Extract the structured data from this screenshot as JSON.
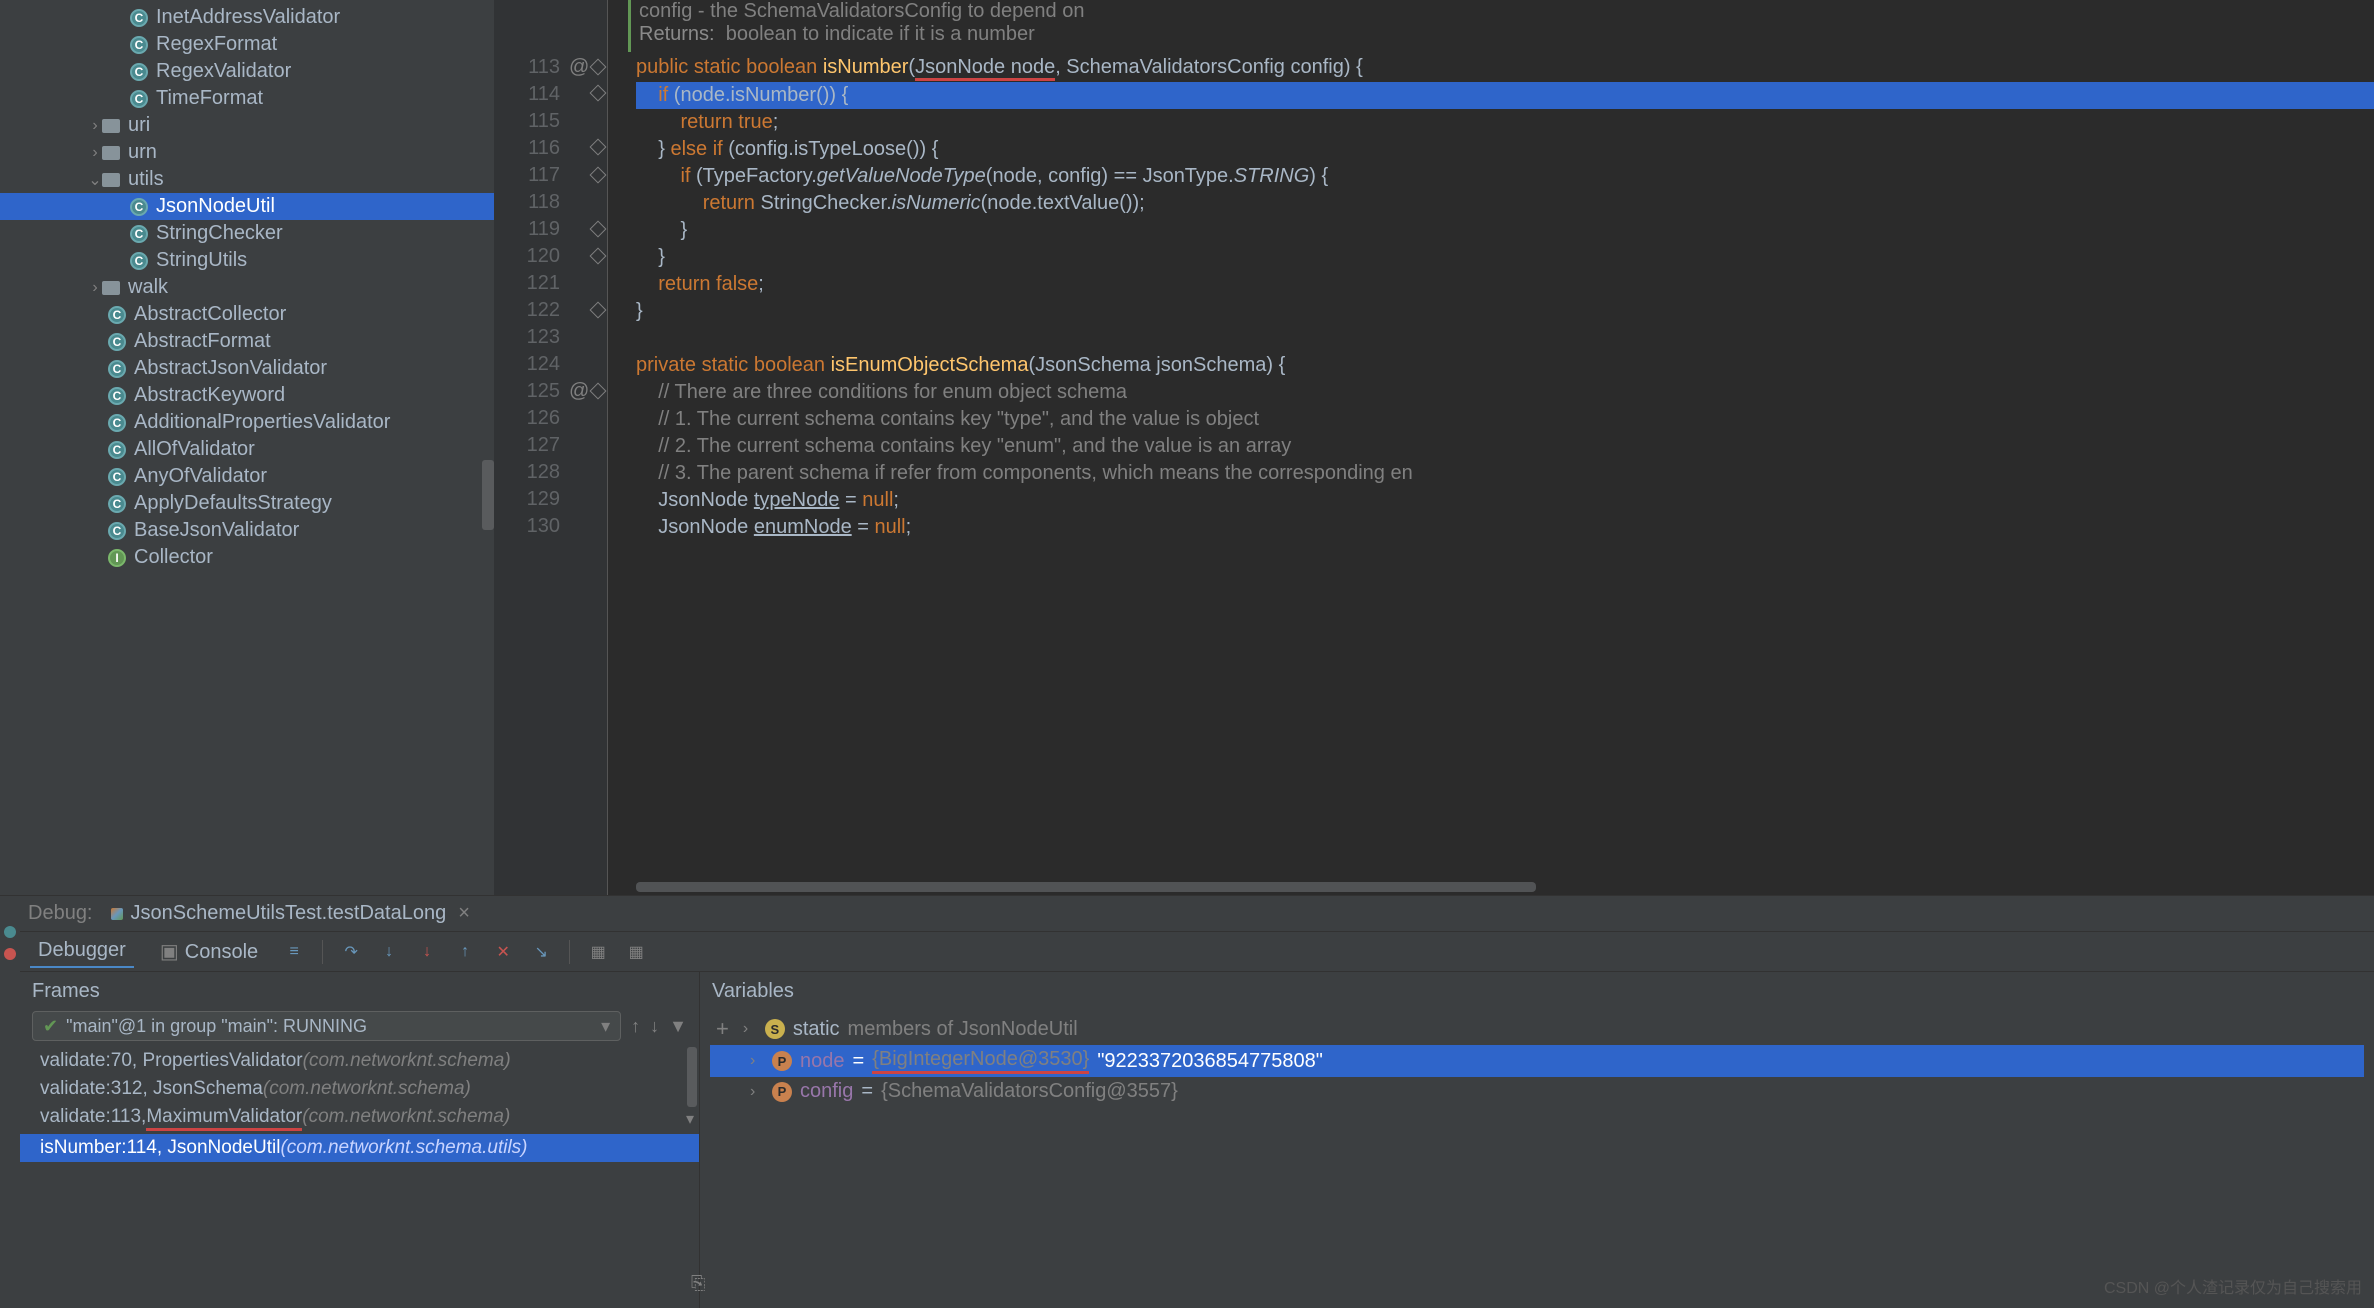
{
  "tree": {
    "items": [
      {
        "indent": 130,
        "icon": "class",
        "label": "InetAddressValidator"
      },
      {
        "indent": 130,
        "icon": "class",
        "label": "RegexFormat"
      },
      {
        "indent": 130,
        "icon": "class",
        "label": "RegexValidator"
      },
      {
        "indent": 130,
        "icon": "class",
        "label": "TimeFormat"
      },
      {
        "indent": 88,
        "chev": "›",
        "icon": "folder",
        "label": "uri"
      },
      {
        "indent": 88,
        "chev": "›",
        "icon": "folder",
        "label": "urn"
      },
      {
        "indent": 88,
        "chev": "⌄",
        "icon": "folder",
        "label": "utils"
      },
      {
        "indent": 130,
        "icon": "class",
        "label": "JsonNodeUtil",
        "sel": true
      },
      {
        "indent": 130,
        "icon": "class",
        "label": "StringChecker"
      },
      {
        "indent": 130,
        "icon": "class",
        "label": "StringUtils"
      },
      {
        "indent": 88,
        "chev": "›",
        "icon": "folder",
        "label": "walk"
      },
      {
        "indent": 108,
        "icon": "class",
        "label": "AbstractCollector"
      },
      {
        "indent": 108,
        "icon": "class",
        "label": "AbstractFormat"
      },
      {
        "indent": 108,
        "icon": "class",
        "label": "AbstractJsonValidator"
      },
      {
        "indent": 108,
        "icon": "class",
        "label": "AbstractKeyword"
      },
      {
        "indent": 108,
        "icon": "class",
        "label": "AdditionalPropertiesValidator"
      },
      {
        "indent": 108,
        "icon": "class",
        "label": "AllOfValidator"
      },
      {
        "indent": 108,
        "icon": "class",
        "label": "AnyOfValidator"
      },
      {
        "indent": 108,
        "icon": "class",
        "label": "ApplyDefaultsStrategy"
      },
      {
        "indent": 108,
        "icon": "class",
        "label": "BaseJsonValidator"
      },
      {
        "indent": 108,
        "icon": "iface",
        "label": "Collector"
      }
    ]
  },
  "doc": {
    "l1": "config - the SchemaValidatorsConfig to depend on",
    "ret": "Returns:",
    "l2": "boolean to indicate if it is a number"
  },
  "code": {
    "first_line": 113,
    "lines": [
      {
        "t": "<kw>public</kw> <kw>static</kw> <kw>boolean</kw> <fn>isNumber</fn>(<u>JsonNode node</u>, SchemaValidatorsConfig config) {"
      },
      {
        "t": "    <kw>if</kw> (node.isNumber()) {",
        "cur": true
      },
      {
        "t": "        <kw>return true</kw>;"
      },
      {
        "t": "    } <kw>else if</kw> (config.isTypeLoose()) {"
      },
      {
        "t": "        <kw>if</kw> (TypeFactory.<it>getValueNodeType</it>(node, config) == JsonType.<it>STRING</it>) {"
      },
      {
        "t": "            <kw>return</kw> StringChecker.<it>isNumeric</it>(node.textValue());"
      },
      {
        "t": "        }"
      },
      {
        "t": "    }"
      },
      {
        "t": "    <kw>return false</kw>;"
      },
      {
        "t": "}"
      },
      {
        "t": ""
      },
      {
        "t": "<kw>private</kw> <kw>static</kw> <kw>boolean</kw> <fn>isEnumObjectSchema</fn>(JsonSchema jsonSchema) {"
      },
      {
        "t": "    <cm>// There are three conditions for enum object schema</cm>"
      },
      {
        "t": "    <cm>// 1. The current schema contains key \"type\", and the value is object</cm>"
      },
      {
        "t": "    <cm>// 2. The current schema contains key \"enum\", and the value is an array</cm>"
      },
      {
        "t": "    <cm>// 3. The parent schema if refer from components, which means the corresponding en</cm>"
      },
      {
        "t": "    JsonNode <ul>typeNode</ul> = <kw>null</kw>;"
      },
      {
        "t": "    JsonNode <ul>enumNode</ul> = <kw>null</kw>;"
      }
    ]
  },
  "debug": {
    "label": "Debug:",
    "tab": "JsonSchemeUtilsTest.testDataLong",
    "toolbar": {
      "debugger": "Debugger",
      "console": "Console"
    },
    "frames": {
      "title": "Frames",
      "thread": "\"main\"@1 in group \"main\": RUNNING",
      "stack": [
        {
          "main": "isNumber:114, JsonNodeUtil ",
          "dim": "(com.networknt.schema.utils)",
          "sel": true
        },
        {
          "main": "validate:113, ",
          "red": "MaximumValidator",
          "dim": " (com.networknt.schema)"
        },
        {
          "main": "validate:312, JsonSchema ",
          "dim": "(com.networknt.schema)"
        },
        {
          "main": "validate:70, PropertiesValidator ",
          "dim": "(com.networknt.schema)"
        }
      ]
    },
    "variables": {
      "title": "Variables",
      "rows": [
        {
          "icon": "s",
          "label": "static",
          "rest": " members of JsonNodeUtil"
        },
        {
          "icon": "p",
          "name": "node",
          "eq": " = ",
          "val": "{BigIntegerNode@3530}",
          "str": " \"9223372036854775808\"",
          "sel": true,
          "redunder": true
        },
        {
          "icon": "p",
          "name": "config",
          "eq": " = ",
          "val": "{SchemaValidatorsConfig@3557}"
        }
      ]
    }
  },
  "watermark": "CSDN @个人渣记录仅为自己搜索用"
}
